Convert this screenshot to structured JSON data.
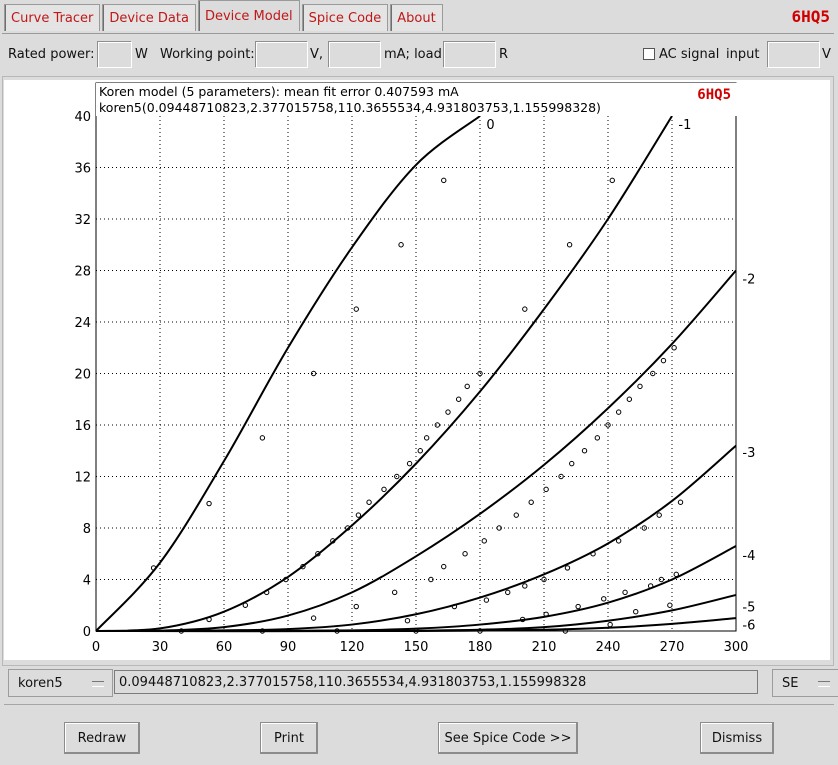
{
  "tabs": [
    "Curve Tracer",
    "Device Data",
    "Device Model",
    "Spice Code",
    "About"
  ],
  "active_tab": 2,
  "tube_name": "6HQ5",
  "controls": {
    "rated_power_label": "Rated power:",
    "rated_power_unit": "W",
    "working_point_label": "Working point:",
    "volts_unit": "V,",
    "ma_load_label": "mA; load",
    "ohms_unit": "R",
    "ac_signal_label": "AC signal",
    "input_label": "input",
    "input_unit": "V"
  },
  "model": {
    "selected": "koren5",
    "params": "0.09448710823,2.377015758,110.3655534,4.931803753,1.155998328",
    "circuit": "SE"
  },
  "buttons": {
    "redraw": "Redraw",
    "print": "Print",
    "spice": "See Spice Code >>",
    "dismiss": "Dismiss"
  },
  "chart_data": {
    "type": "line",
    "title": "Koren model (5 parameters): mean fit error 0.407593 mA",
    "subtitle": "koren5(0.09448710823,2.377015758,110.3655534,4.931803753,1.155998328)",
    "xlabel": "",
    "ylabel": "",
    "xlim": [
      0,
      300
    ],
    "ylim": [
      0,
      40
    ],
    "x_ticks": [
      0,
      30,
      60,
      90,
      120,
      150,
      180,
      210,
      240,
      270,
      300
    ],
    "y_ticks": [
      0,
      4,
      8,
      12,
      16,
      20,
      24,
      28,
      32,
      36,
      40
    ],
    "grid": true,
    "series": [
      {
        "name": "0",
        "label_at": [
          183,
          39.0
        ],
        "x": [
          0,
          30,
          60,
          90,
          120,
          150,
          180
        ],
        "y": [
          0,
          5.3,
          13.2,
          22.0,
          29.8,
          36.2,
          40.0
        ]
      },
      {
        "name": "-1",
        "label_at": [
          273,
          39.0
        ],
        "x": [
          0,
          30,
          60,
          90,
          120,
          150,
          180,
          210,
          240,
          270
        ],
        "y": [
          0,
          0.2,
          1.5,
          4.2,
          8.2,
          13.0,
          18.6,
          25.0,
          32.0,
          40.0
        ]
      },
      {
        "name": "-2",
        "label_at": [
          303,
          27.0
        ],
        "x": [
          0,
          30,
          60,
          90,
          120,
          150,
          180,
          210,
          240,
          270,
          300
        ],
        "y": [
          0,
          0.03,
          0.3,
          1.2,
          3.0,
          5.8,
          9.1,
          12.9,
          17.3,
          22.3,
          28.0
        ]
      },
      {
        "name": "-3",
        "label_at": [
          303,
          13.5
        ],
        "x": [
          0,
          30,
          60,
          90,
          120,
          150,
          180,
          210,
          240,
          270,
          300
        ],
        "y": [
          0,
          0,
          0.05,
          0.15,
          0.5,
          1.3,
          2.6,
          4.4,
          6.8,
          10.1,
          14.4
        ]
      },
      {
        "name": "-4",
        "label_at": [
          303,
          5.5
        ],
        "x": [
          0,
          60,
          120,
          150,
          180,
          210,
          240,
          270,
          300
        ],
        "y": [
          0,
          0,
          0.05,
          0.18,
          0.5,
          1.1,
          2.2,
          4.0,
          6.6
        ]
      },
      {
        "name": "-5",
        "label_at": [
          303,
          1.5
        ],
        "x": [
          0,
          120,
          180,
          210,
          240,
          270,
          300
        ],
        "y": [
          0,
          0,
          0.1,
          0.3,
          0.8,
          1.6,
          2.8
        ]
      },
      {
        "name": "-6",
        "label_at": [
          303,
          0.1
        ],
        "x": [
          0,
          150,
          210,
          240,
          270,
          300
        ],
        "y": [
          0,
          0,
          0.1,
          0.25,
          0.55,
          1.0
        ]
      }
    ],
    "measured_points": [
      [
        27,
        4.9
      ],
      [
        53,
        9.9
      ],
      [
        78,
        15.0
      ],
      [
        102,
        20.0
      ],
      [
        122,
        25.0
      ],
      [
        143,
        30.0
      ],
      [
        163,
        35.0
      ],
      [
        53,
        0.9
      ],
      [
        70,
        2.0
      ],
      [
        80,
        3.0
      ],
      [
        89,
        4.0
      ],
      [
        97,
        5.0
      ],
      [
        104,
        6.0
      ],
      [
        111,
        7.0
      ],
      [
        118,
        8.0
      ],
      [
        123,
        9.0
      ],
      [
        128,
        10.0
      ],
      [
        135,
        11.0
      ],
      [
        141,
        12.0
      ],
      [
        147,
        13.0
      ],
      [
        152,
        14.0
      ],
      [
        155,
        15.0
      ],
      [
        160,
        16.0
      ],
      [
        165,
        17.0
      ],
      [
        170,
        18.0
      ],
      [
        174,
        19.0
      ],
      [
        180,
        20.0
      ],
      [
        201,
        25.0
      ],
      [
        222,
        30.0
      ],
      [
        242,
        35.0
      ],
      [
        102,
        1.0
      ],
      [
        122,
        1.9
      ],
      [
        140,
        3.0
      ],
      [
        146,
        0.8
      ],
      [
        157,
        4.0
      ],
      [
        163,
        5.0
      ],
      [
        173,
        6.0
      ],
      [
        182,
        7.0
      ],
      [
        189,
        8.0
      ],
      [
        197,
        9.0
      ],
      [
        204,
        10.0
      ],
      [
        211,
        11.0
      ],
      [
        218,
        12.0
      ],
      [
        223,
        13.0
      ],
      [
        229,
        14.0
      ],
      [
        235,
        15.0
      ],
      [
        240,
        16.0
      ],
      [
        245,
        17.0
      ],
      [
        250,
        18.0
      ],
      [
        255,
        19.0
      ],
      [
        261,
        20.0
      ],
      [
        266,
        21.0
      ],
      [
        271,
        22.0
      ],
      [
        168,
        1.9
      ],
      [
        183,
        2.4
      ],
      [
        193,
        3.0
      ],
      [
        201,
        3.5
      ],
      [
        210,
        4.0
      ],
      [
        221,
        4.9
      ],
      [
        233,
        6.0
      ],
      [
        245,
        7.0
      ],
      [
        257,
        8.0
      ],
      [
        264,
        9.0
      ],
      [
        274,
        10.0
      ],
      [
        200,
        0.9
      ],
      [
        211,
        1.3
      ],
      [
        226,
        1.9
      ],
      [
        238,
        2.5
      ],
      [
        248,
        3.0
      ],
      [
        260,
        3.5
      ],
      [
        265,
        4.0
      ],
      [
        272,
        4.4
      ],
      [
        241,
        0.5
      ],
      [
        253,
        1.5
      ],
      [
        269,
        2.0
      ],
      [
        40,
        0.0
      ],
      [
        78,
        0.0
      ],
      [
        113,
        0.0
      ],
      [
        150,
        0.0
      ],
      [
        180,
        0.0
      ],
      [
        220,
        0.0
      ]
    ]
  }
}
